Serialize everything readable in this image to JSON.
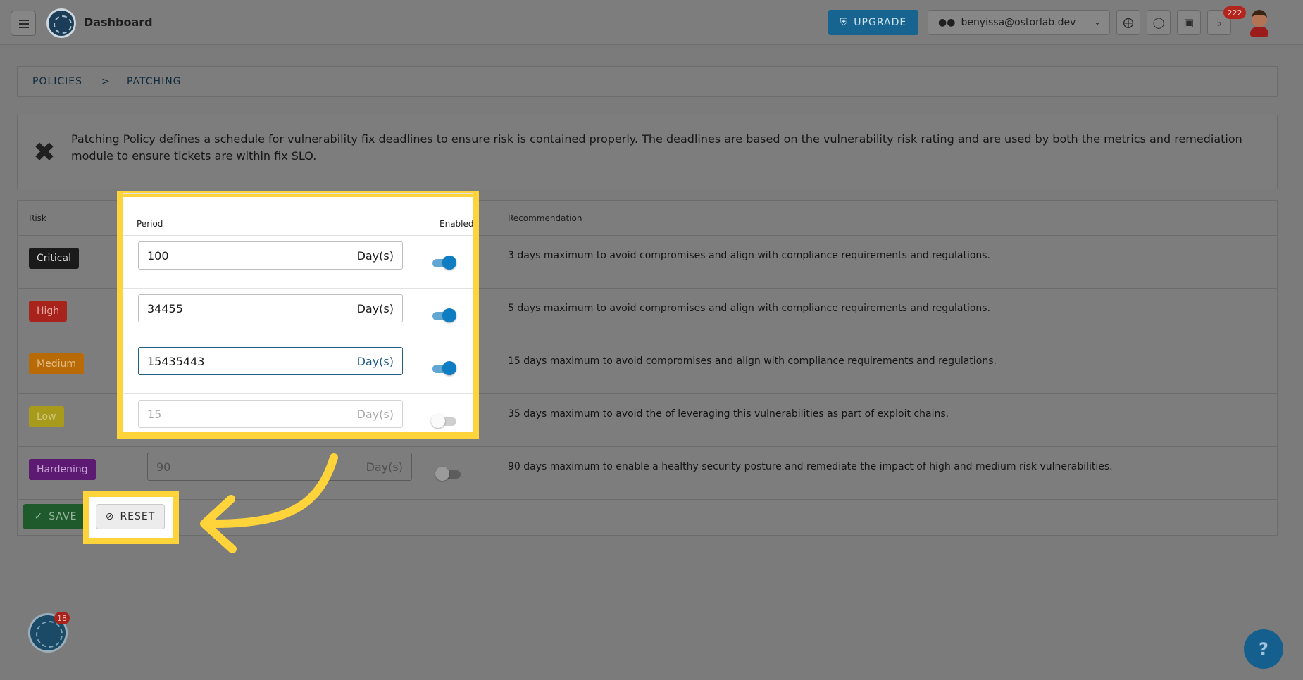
{
  "header": {
    "title": "Dashboard",
    "upgrade_label": "UPGRADE",
    "account_email": "benyissa@ostorlab.dev",
    "notification_count": "222"
  },
  "breadcrumb": {
    "items": [
      "POLICIES",
      "PATCHING"
    ],
    "separator": ">"
  },
  "info": {
    "text": "Patching Policy defines a schedule for vulnerability fix deadlines to ensure risk is contained properly. The deadlines are based on the vulnerability risk rating and are used by both the metrics and remediation module to ensure tickets are within fix SLO."
  },
  "table": {
    "headers": {
      "risk": "Risk",
      "period": "Period",
      "enabled": "Enabled",
      "recommendation": "Recommendation"
    },
    "rows": [
      {
        "risk": "Critical",
        "color": "#1a1a1a",
        "text_color": "#d9d9d9",
        "period": "100",
        "unit": "Day(s)",
        "enabled": true,
        "recommendation": "3 days maximum to avoid compromises and align with compliance requirements and regulations."
      },
      {
        "risk": "High",
        "color": "#a8231c",
        "text_color": "#e4a7a2",
        "period": "34455",
        "unit": "Day(s)",
        "enabled": true,
        "recommendation": "5 days maximum to avoid compromises and align with compliance requirements and regulations."
      },
      {
        "risk": "Medium",
        "color": "#b86a06",
        "text_color": "#e3bb86",
        "period": "15435443",
        "unit": "Day(s)",
        "enabled": true,
        "recommendation": "15 days maximum to avoid compromises and align with compliance requirements and regulations."
      },
      {
        "risk": "Low",
        "color": "#a89a1a",
        "text_color": "#cfc77e",
        "period": "15",
        "unit": "Day(s)",
        "enabled": false,
        "recommendation": "35 days maximum to avoid the of leveraging this vulnerabilities as part of exploit chains."
      },
      {
        "risk": "Hardening",
        "color": "#5d1a72",
        "text_color": "#c6a3d3",
        "period": "90",
        "unit": "Day(s)",
        "enabled": false,
        "recommendation": "90 days maximum to enable a healthy security posture and remediate the impact of high and medium risk vulnerabilities."
      }
    ]
  },
  "actions": {
    "save_label": "SAVE",
    "reset_label": "RESET"
  },
  "fab": {
    "bot_badge": "18",
    "help_label": "?"
  },
  "colors": {
    "highlight": "#ffd43b",
    "accent": "#0f7dc2"
  }
}
